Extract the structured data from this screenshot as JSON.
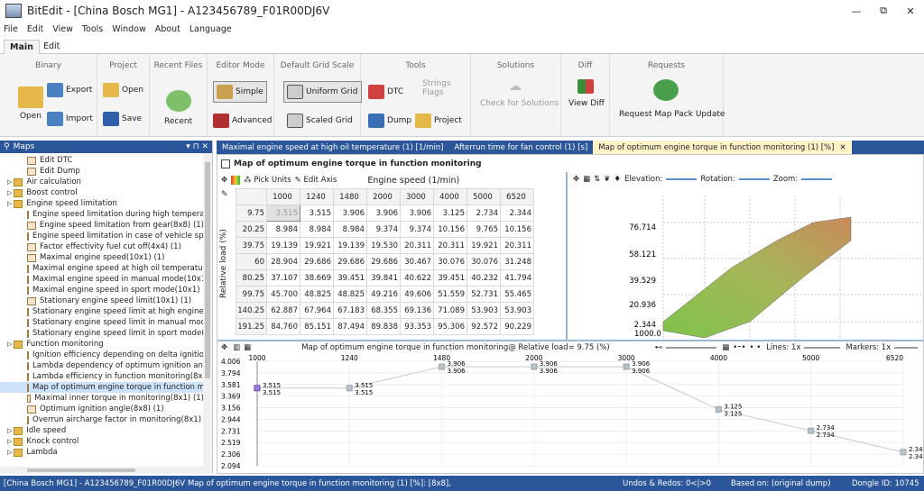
{
  "window": {
    "title": "BitEdit - [China Bosch MG1] - A123456789_F01R00DJ6V",
    "buttons": [
      "—",
      "⧉",
      "✕"
    ]
  },
  "menu": [
    "File",
    "Edit",
    "View",
    "Tools",
    "Window",
    "About",
    "Language"
  ],
  "ribbon_tabs": [
    "Main",
    "Edit"
  ],
  "ribbon": {
    "groups": [
      "Binary",
      "Project",
      "Recent Files",
      "Editor Mode",
      "Default Grid Scale",
      "Tools",
      "Solutions",
      "Diff",
      "Requests"
    ],
    "binary": {
      "open": "Open",
      "export": "Export",
      "import": "Import"
    },
    "project": {
      "open": "Open",
      "save": "Save"
    },
    "recent": "Recent",
    "editor": {
      "simple": "Simple",
      "advanced": "Advanced"
    },
    "grid": {
      "uniform": "Uniform Grid",
      "scaled": "Scaled Grid"
    },
    "tools": {
      "dtc": "DTC",
      "strings": "Strings",
      "flags": "Flags",
      "dump": "Dump",
      "project": "Project"
    },
    "solutions": "Check for Solutions",
    "diff": "View Diff",
    "requests": "Request Map Pack Update"
  },
  "maps_panel": {
    "title": "Maps",
    "pin": "▾ ⊓ ✕"
  },
  "tree": [
    {
      "label": "Edit DTC",
      "level": 1,
      "kind": "leaf"
    },
    {
      "label": "Edit Dump",
      "level": 1,
      "kind": "leaf"
    },
    {
      "label": "Air calculation",
      "level": 0,
      "kind": "folder"
    },
    {
      "label": "Boost control",
      "level": 0,
      "kind": "folder"
    },
    {
      "label": "Engine speed limitation",
      "level": 0,
      "kind": "folder"
    },
    {
      "label": "Engine speed limitation during high temperat",
      "level": 1,
      "kind": "leaf"
    },
    {
      "label": "Engine speed limitation from gear(8x8) (1)",
      "level": 1,
      "kind": "leaf"
    },
    {
      "label": "Engine speed limitation in case of vehicle spe",
      "level": 1,
      "kind": "leaf"
    },
    {
      "label": "Factor effectivity fuel cut off(4x4) (1)",
      "level": 1,
      "kind": "leaf"
    },
    {
      "label": "Maximal engine speed(10x1) (1)",
      "level": 1,
      "kind": "leaf"
    },
    {
      "label": "Maximal engine speed at high oil temperature",
      "level": 1,
      "kind": "leaf"
    },
    {
      "label": "Maximal engine speed in manual mode(10x1)",
      "level": 1,
      "kind": "leaf"
    },
    {
      "label": "Maximal engine speed in sport mode(10x1) (1",
      "level": 1,
      "kind": "leaf"
    },
    {
      "label": "Stationary engine speed limit(10x1) (1)",
      "level": 1,
      "kind": "leaf"
    },
    {
      "label": "Stationary engine speed limit at high engine t",
      "level": 1,
      "kind": "leaf"
    },
    {
      "label": "Stationary engine speed limit in manual mode",
      "level": 1,
      "kind": "leaf"
    },
    {
      "label": "Stationary engine speed limit in sport mode(1",
      "level": 1,
      "kind": "leaf"
    },
    {
      "label": "Function monitoring",
      "level": 0,
      "kind": "folder"
    },
    {
      "label": "Ignition efficiency depending on delta ignitior",
      "level": 1,
      "kind": "leaf"
    },
    {
      "label": "Lambda dependency of optimum ignition ang",
      "level": 1,
      "kind": "leaf"
    },
    {
      "label": "Lambda efficiency in function monitoring(8x1)",
      "level": 1,
      "kind": "leaf"
    },
    {
      "label": "Map of optimum engine torque in function m",
      "level": 1,
      "kind": "leaf",
      "selected": true
    },
    {
      "label": "Maximal inner torque in monitoring(8x1) (1)",
      "level": 1,
      "kind": "leaf"
    },
    {
      "label": "Optimum ignition angle(8x8) (1)",
      "level": 1,
      "kind": "leaf"
    },
    {
      "label": "Overrun aircharge factor in monitoring(8x1) (1",
      "level": 1,
      "kind": "leaf"
    },
    {
      "label": "Idle speed",
      "level": 0,
      "kind": "folder"
    },
    {
      "label": "Knock control",
      "level": 0,
      "kind": "folder"
    },
    {
      "label": "Lambda",
      "level": 0,
      "kind": "folder"
    }
  ],
  "doc_tabs": [
    "Maximal engine speed at high oil temperature (1) [1/min]",
    "Afterrun time for fan control (1) [s]",
    "Map of optimum engine torque in function monitoring (1) [%]"
  ],
  "map_title": "Map of optimum engine torque in function monitoring",
  "table_tools": {
    "pick_units": "Pick Units",
    "edit_axis": "Edit Axis"
  },
  "x_axis_label": "Engine speed (1/min)",
  "y_axis_label": "Relative load (%)",
  "col_headers": [
    "1000",
    "1240",
    "1480",
    "2000",
    "3000",
    "4000",
    "5000",
    "6520"
  ],
  "row_headers": [
    "9.75",
    "20.25",
    "39.75",
    "60",
    "80.25",
    "99.75",
    "140.25",
    "191.25"
  ],
  "cells": [
    [
      "3.515",
      "3.515",
      "3.906",
      "3.906",
      "3.906",
      "3.125",
      "2.734",
      "2.344"
    ],
    [
      "8.984",
      "8.984",
      "8.984",
      "9.374",
      "9.374",
      "10.156",
      "9.765",
      "10.156"
    ],
    [
      "19.139",
      "19.921",
      "19.139",
      "19.530",
      "20.311",
      "20.311",
      "19.921",
      "20.311"
    ],
    [
      "28.904",
      "29.686",
      "29.686",
      "29.686",
      "30.467",
      "30.076",
      "30.076",
      "31.248"
    ],
    [
      "37.107",
      "38.669",
      "39.451",
      "39.841",
      "40.622",
      "39.451",
      "40.232",
      "41.794"
    ],
    [
      "45.700",
      "48.825",
      "48.825",
      "49.216",
      "49.606",
      "51.559",
      "52.731",
      "55.465"
    ],
    [
      "62.887",
      "67.964",
      "67.183",
      "68.355",
      "69.136",
      "71.089",
      "53.903",
      "53.903"
    ],
    [
      "84.760",
      "85.151",
      "87.494",
      "89.838",
      "93.353",
      "95.306",
      "92.572",
      "90.229"
    ]
  ],
  "plot3d": {
    "elevation": "Elevation:",
    "rotation": "Rotation:",
    "zoom": "Zoom:",
    "zlabels": [
      "76.714",
      "58.121",
      "39.529",
      "20.936",
      "2.344"
    ],
    "corner": "1000.0"
  },
  "line_plot": {
    "title": "Map of optimum engine torque in function monitoring@ Relative load= 9.75 (%)",
    "lines": "Lines: 1x",
    "markers": "Markers: 1x",
    "ylabels": [
      "4.006",
      "3.794",
      "3.581",
      "3.369",
      "3.156",
      "2.944",
      "2.731",
      "2.519",
      "2.306",
      "2.094"
    ],
    "xlabels": [
      "1000",
      "1240",
      "1480",
      "2000",
      "3000",
      "4000",
      "5000",
      "6520"
    ]
  },
  "chart_data": {
    "type": "line",
    "title": "Map of optimum engine torque in function monitoring@ Relative load= 9.75 (%)",
    "x": [
      1000,
      1240,
      1480,
      2000,
      3000,
      4000,
      5000,
      6520
    ],
    "series": [
      {
        "values": [
          3.515,
          3.515,
          3.906,
          3.906,
          3.906,
          3.125,
          2.734,
          2.344
        ]
      }
    ],
    "ylim": [
      2.094,
      4.006
    ],
    "xlim": [
      1000,
      6520
    ]
  },
  "status": {
    "project": "[China Bosch MG1] - A123456789_F01R00DJ6V",
    "map": "Map of optimum engine torque in function monitoring (1) [%]: [8x8],",
    "undo": "Undos & Redos: 0<|>0",
    "based": "Based on: (original dump)",
    "dongle": "Dongle ID: 10745"
  }
}
